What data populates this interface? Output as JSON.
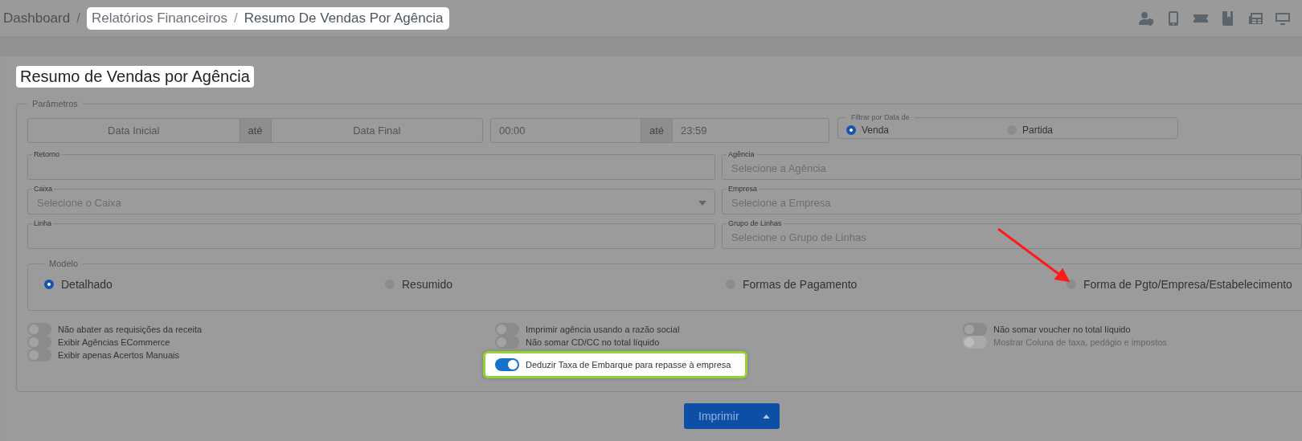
{
  "breadcrumb": [
    {
      "label": "Dashboard",
      "separator": "/",
      "highlighted": false
    },
    {
      "label": "Relatórios Financeiros",
      "separator": "/",
      "highlighted": true
    },
    {
      "label": "Resumo De Vendas Por Agência",
      "highlighted": true
    }
  ],
  "page_title": {
    "text": "Resumo de Vendas por Agência",
    "highlighted": true
  },
  "parameters": {
    "legend": "Parâmetros",
    "date_range": {
      "start_placeholder": "Data Inicial",
      "joiner": "até",
      "end_placeholder": "Data Final"
    },
    "time_range": {
      "start": "00:00",
      "joiner": "até",
      "end": "23:59"
    },
    "date_filter": {
      "legend": "Filtrar por Data de",
      "options": [
        {
          "label": "Venda",
          "selected": true
        },
        {
          "label": "Partida",
          "selected": false
        }
      ]
    },
    "fields": [
      {
        "label": "Retorno",
        "kind": "text"
      },
      {
        "label": "Agência",
        "kind": "text",
        "placeholder": "Selecione a Agência"
      },
      {
        "label": "Caixa",
        "kind": "select",
        "placeholder": "Selecione o Caixa"
      },
      {
        "label": "Empresa",
        "kind": "text",
        "placeholder": "Selecione a Empresa"
      },
      {
        "label": "Linha",
        "kind": "text"
      },
      {
        "label": "Grupo de Linhas",
        "kind": "text",
        "placeholder": "Selecione o Grupo de Linhas"
      }
    ],
    "model": {
      "legend": "Modelo",
      "options": [
        {
          "label": "Detalhado",
          "selected": true,
          "pointed_at": false
        },
        {
          "label": "Resumido",
          "selected": false,
          "pointed_at": false
        },
        {
          "label": "Formas de Pagamento",
          "selected": false,
          "pointed_at": false
        },
        {
          "label": "Forma de Pgto/Empresa/Estabelecimento",
          "selected": false,
          "pointed_at": true
        }
      ]
    },
    "toggle_columns": [
      {
        "items": [
          {
            "label": "Não abater as requisições da receita",
            "on": false,
            "disabled": false,
            "highlighted": false
          },
          {
            "label": "Exibir Agências ECommerce",
            "on": false,
            "disabled": false,
            "highlighted": false
          },
          {
            "label": "Exibir apenas Acertos Manuais",
            "on": false,
            "disabled": false,
            "highlighted": false
          }
        ]
      },
      {
        "items": [
          {
            "label": "Imprimir agência usando a razão social",
            "on": false,
            "disabled": false,
            "highlighted": false
          },
          {
            "label": "Não somar CD/CC no total líquido",
            "on": false,
            "disabled": false,
            "highlighted": false
          },
          {
            "label": "Deduzir Taxa de Embarque para repasse à empresa",
            "on": true,
            "disabled": false,
            "highlighted": true
          }
        ]
      },
      {
        "items": [
          {
            "label": "Não somar voucher no total líquido",
            "on": false,
            "disabled": false,
            "highlighted": false
          },
          {
            "label": "Mostrar Coluna de taxa, pedágio e impostos",
            "on": false,
            "disabled": true,
            "highlighted": false
          }
        ]
      }
    ]
  },
  "print_button": {
    "label": "Imprimir"
  }
}
